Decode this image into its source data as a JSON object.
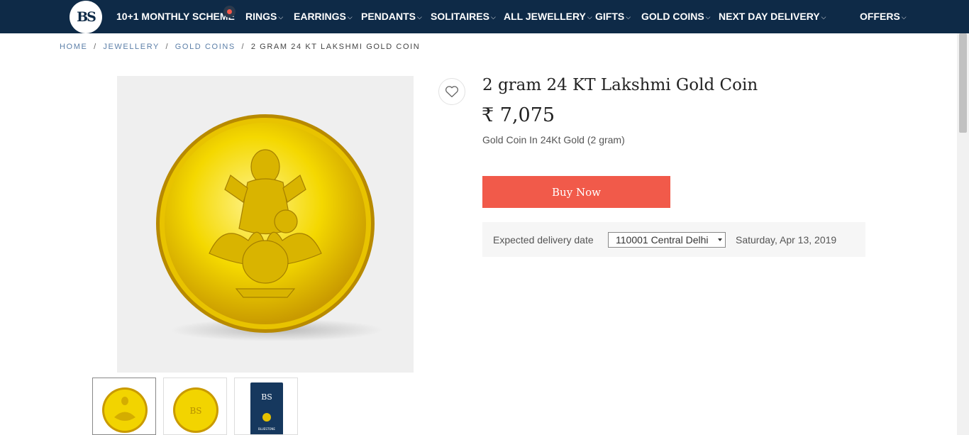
{
  "nav": {
    "logo": "BS",
    "items": [
      {
        "label": "10+1 MONTHLY SCHEME",
        "chevron": false
      },
      {
        "label": "RINGS",
        "chevron": true
      },
      {
        "label": "EARRINGS",
        "chevron": true
      },
      {
        "label": "PENDANTS",
        "chevron": true
      },
      {
        "label": "SOLITAIRES",
        "chevron": true
      },
      {
        "label": "ALL JEWELLERY",
        "chevron": true
      },
      {
        "label": "GIFTS",
        "chevron": true
      },
      {
        "label": "GOLD COINS",
        "chevron": true
      },
      {
        "label": "NEXT DAY DELIVERY",
        "chevron": true
      },
      {
        "label": "OFFERS",
        "chevron": true
      }
    ],
    "chevron_glyph": "⌵"
  },
  "breadcrumb": {
    "items": [
      "HOME",
      "JEWELLERY",
      "GOLD COINS",
      "2 GRAM 24 KT LAKSHMI GOLD COIN"
    ],
    "separator": "/"
  },
  "product": {
    "title": "2 gram 24 KT Lakshmi Gold Coin",
    "price": "₹ 7,075",
    "subtitle": "Gold Coin In 24Kt Gold (2 gram)",
    "buy_label": "Buy Now",
    "wishlist_icon": "heart-outline-icon"
  },
  "delivery": {
    "label": "Expected delivery date",
    "pincode": "110001 Central Delhi",
    "date": "Saturday, Apr 13, 2019"
  },
  "thumbnails": {
    "box_brand": "BLUESTONE"
  },
  "colors": {
    "nav_bg": "#0e2a47",
    "accent": "#f15a4a",
    "gold": "#e6c200",
    "breadcrumb_link": "#5c7fa8"
  }
}
